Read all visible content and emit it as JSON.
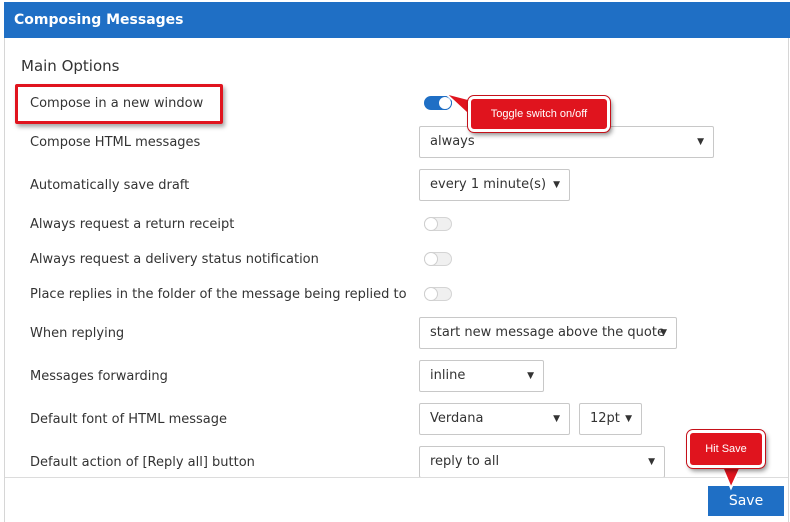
{
  "header": {
    "title": "Composing Messages"
  },
  "section": {
    "title": "Main Options"
  },
  "rows": {
    "compose_window": {
      "label": "Compose in a new window",
      "enabled": true
    },
    "compose_html": {
      "label": "Compose HTML messages",
      "value": "always"
    },
    "auto_save": {
      "label": "Automatically save draft",
      "value": "every 1 minute(s)"
    },
    "return_receipt": {
      "label": "Always request a return receipt",
      "enabled": false
    },
    "delivery_status": {
      "label": "Always request a delivery status notification",
      "enabled": false
    },
    "replies_folder": {
      "label": "Place replies in the folder of the message being replied to",
      "enabled": false
    },
    "when_replying": {
      "label": "When replying",
      "value": "start new message above the quote"
    },
    "forwarding": {
      "label": "Messages forwarding",
      "value": "inline"
    },
    "default_font": {
      "label": "Default font of HTML message",
      "font": "Verdana",
      "size": "12pt"
    },
    "reply_all": {
      "label": "Default action of [Reply all] button",
      "value": "reply to all"
    }
  },
  "callouts": {
    "toggle": "Toggle switch on/off",
    "save": "Hit Save"
  },
  "footer": {
    "save_label": "Save"
  },
  "colors": {
    "accent": "#1f6fc5",
    "annotation": "#e0141e"
  },
  "icons": {
    "dropdown": "chevron-down-icon"
  }
}
